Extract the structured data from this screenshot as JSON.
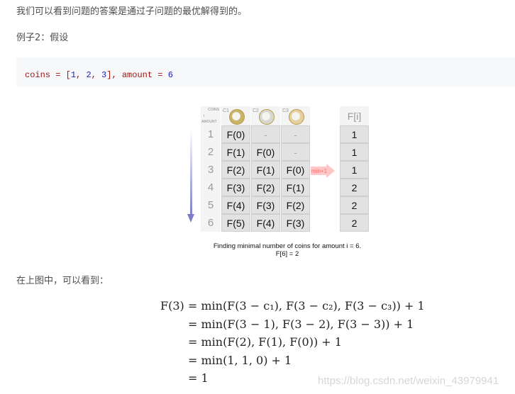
{
  "paragraphs": {
    "intro": "我们可以看到问题的答案是通过子问题的最优解得到的。",
    "example": "例子2：假设",
    "after_figure": "在上图中，可以看到："
  },
  "code": {
    "var1": "coins",
    "eq": " = ",
    "open": "[",
    "n1": "1",
    "c1": ", ",
    "n2": "2",
    "c2": ", ",
    "n3": "3",
    "close": "], ",
    "var2": "amount",
    "eq2": " = ",
    "n4": "6"
  },
  "figure": {
    "header_corner_top": "COINS",
    "header_corner_mid": "i",
    "header_corner_bottom": "AMOUNT",
    "coin_labels": [
      "C1",
      "C2",
      "C3"
    ],
    "coin_colors": [
      "#c9b36a",
      "#d8d8d0",
      "#e6cfa0"
    ],
    "rows": [
      {
        "amount": "1",
        "cells": [
          "F(0)",
          "-",
          "-"
        ],
        "result": "1"
      },
      {
        "amount": "2",
        "cells": [
          "F(1)",
          "F(0)",
          "-"
        ],
        "result": "1"
      },
      {
        "amount": "3",
        "cells": [
          "F(2)",
          "F(1)",
          "F(0)"
        ],
        "result": "1"
      },
      {
        "amount": "4",
        "cells": [
          "F(3)",
          "F(2)",
          "F(1)"
        ],
        "result": "2"
      },
      {
        "amount": "5",
        "cells": [
          "F(4)",
          "F(3)",
          "F(2)"
        ],
        "result": "2"
      },
      {
        "amount": "6",
        "cells": [
          "F(5)",
          "F(4)",
          "F(3)"
        ],
        "result": "2"
      }
    ],
    "result_header": "F[i]",
    "arrow_label": "min+1",
    "caption_line1": "Finding minimal number of coins for amount i = 6.",
    "caption_line2": "F[6] = 2"
  },
  "math": {
    "lines": [
      "F(3) = min(F(3 − c₁), F(3 − c₂), F(3 − c₃)) + 1",
      "= min(F(3 − 1), F(3 − 2), F(3 − 3)) + 1",
      "= min(F(2), F(1), F(0)) + 1",
      "= min(1, 1, 0) + 1",
      "= 1"
    ]
  },
  "watermark": "https://blog.csdn.net/weixin_43979941"
}
